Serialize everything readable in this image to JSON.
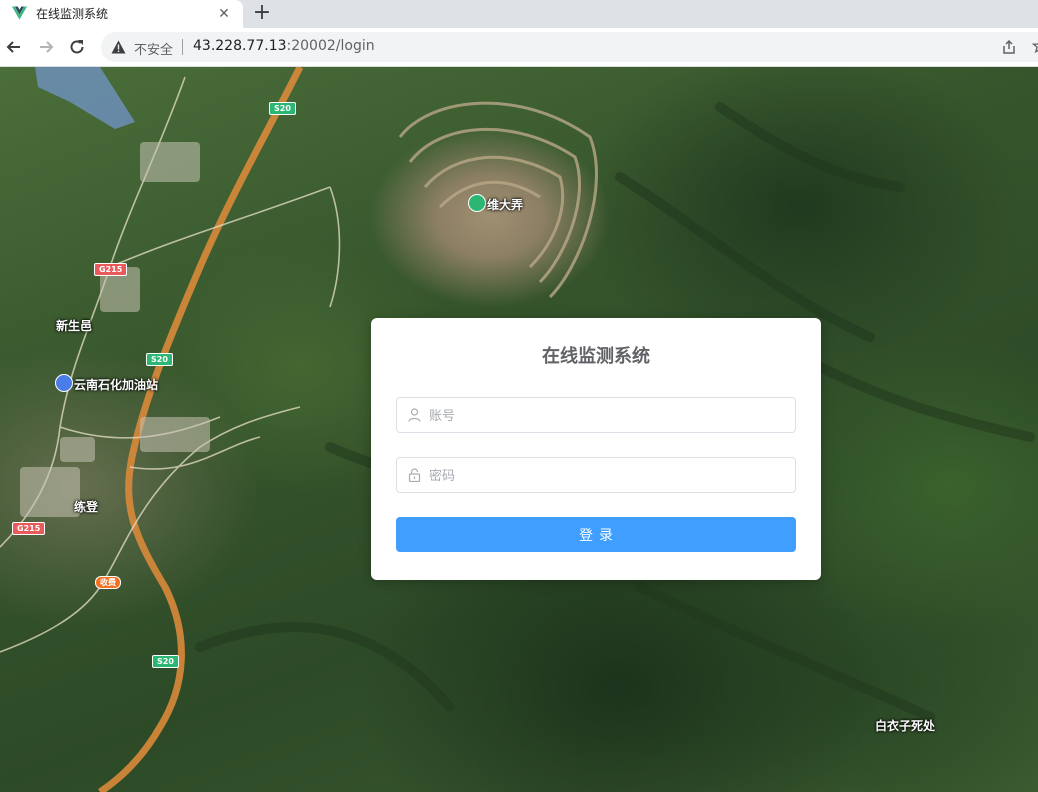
{
  "browser": {
    "tab_title": "在线监测系统",
    "new_tab_symbol": "+",
    "close_symbol": "✕",
    "security_label": "不安全",
    "url_host": "43.228.77.13",
    "url_path": ":20002/login"
  },
  "map": {
    "labels": {
      "xinshengyi": "新生邑",
      "gas_station": "云南石化加油站",
      "liandeng": "练登",
      "weidanong": "维大弄",
      "baiyizi": "白衣子死处"
    },
    "road_shields": {
      "s20": "S20",
      "g215": "G215",
      "toll": "收费"
    },
    "colors": {
      "highway": "#d98a3a",
      "road": "#e8e0c8"
    }
  },
  "login": {
    "title": "在线监测系统",
    "username_placeholder": "账号",
    "password_placeholder": "密码",
    "submit_label": "登录",
    "accent_color": "#409eff"
  }
}
